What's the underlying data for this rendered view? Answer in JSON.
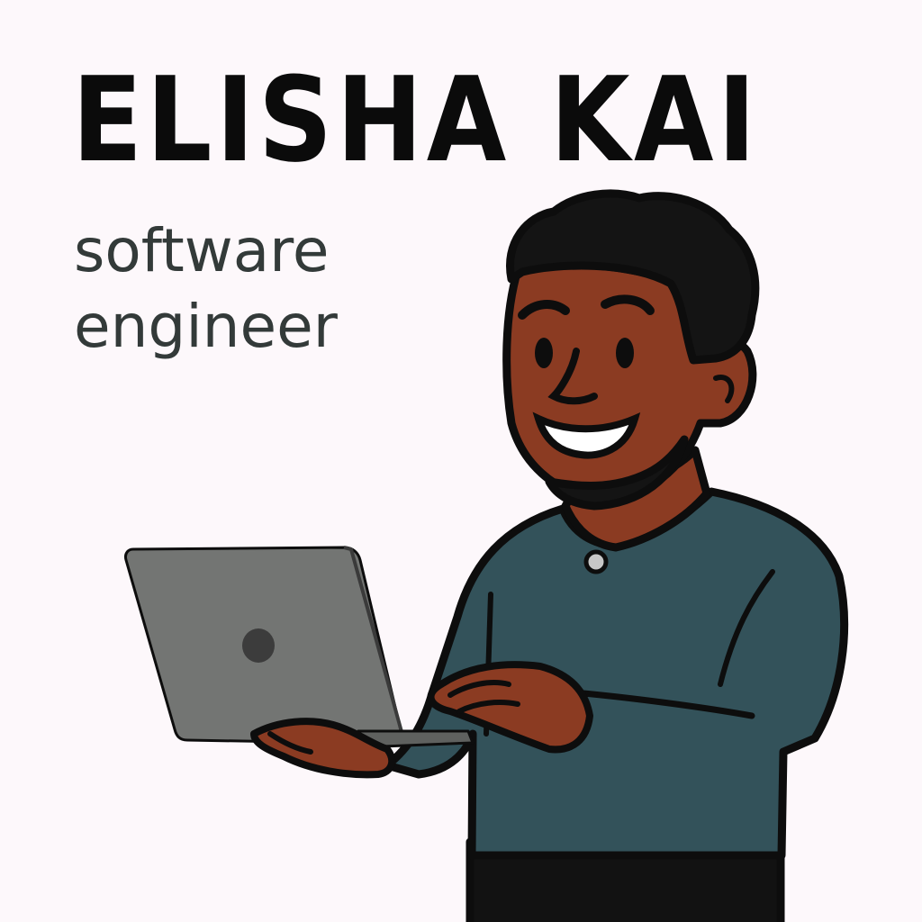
{
  "profile": {
    "name": "ELISHA KAI",
    "role_line_1": "software",
    "role_line_2": "engineer"
  },
  "illustration": {
    "subject": "person-holding-laptop-icon",
    "colors": {
      "background": "#fdf8fb",
      "skin": "#8b3b22",
      "hair": "#141414",
      "sweater": "#33525a",
      "laptop": "#737573",
      "laptop_logo": "#3c3c3c",
      "pants": "#121212",
      "outline": "#0d0d0d",
      "name_text": "#0b0b0b",
      "role_text": "#333a39"
    }
  }
}
